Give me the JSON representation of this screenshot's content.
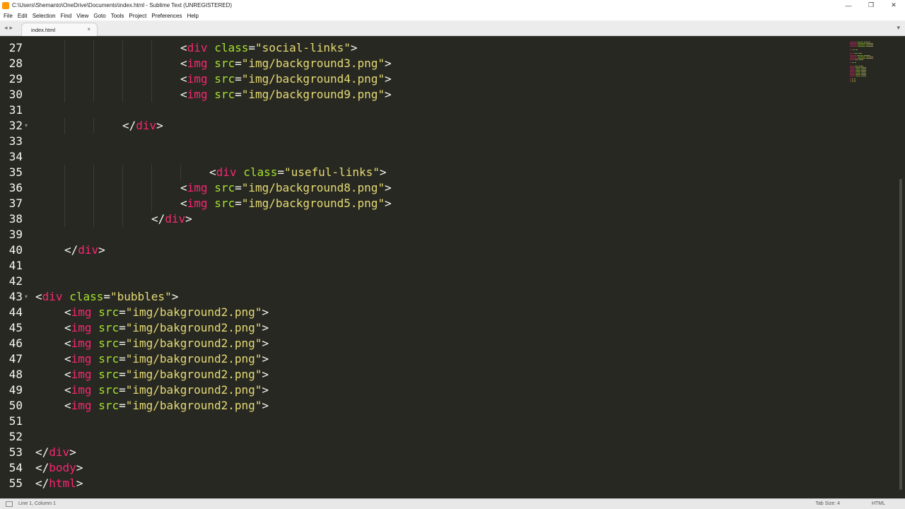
{
  "window": {
    "title": "C:\\Users\\Shemanto\\OneDrive\\Documents\\index.html - Sublime Text (UNREGISTERED)",
    "minimize_label": "—",
    "maximize_label": "❐",
    "close_label": "✕"
  },
  "menu": [
    "File",
    "Edit",
    "Selection",
    "Find",
    "View",
    "Goto",
    "Tools",
    "Project",
    "Preferences",
    "Help"
  ],
  "tabs": {
    "nav_back": "◂",
    "nav_forward": "▸",
    "active": {
      "label": "index.html",
      "close": "×"
    },
    "dropdown": "▾"
  },
  "editor": {
    "lines": [
      {
        "num": "27",
        "tokens": [
          [
            "p",
            "<"
          ],
          [
            "t",
            "div"
          ],
          [
            "x",
            " "
          ],
          [
            "a",
            "class"
          ],
          [
            "p",
            "="
          ],
          [
            "s",
            "\"social-links\""
          ],
          [
            "p",
            ">"
          ]
        ],
        "indent": 205
      },
      {
        "num": "28",
        "tokens": [
          [
            "p",
            "<"
          ],
          [
            "t",
            "img"
          ],
          [
            "x",
            " "
          ],
          [
            "a",
            "src"
          ],
          [
            "p",
            "="
          ],
          [
            "s",
            "\"img/background3.png\""
          ],
          [
            "p",
            ">"
          ]
        ],
        "indent": 205
      },
      {
        "num": "29",
        "tokens": [
          [
            "p",
            "<"
          ],
          [
            "t",
            "img"
          ],
          [
            "x",
            " "
          ],
          [
            "a",
            "src"
          ],
          [
            "p",
            "="
          ],
          [
            "s",
            "\"img/background4.png\""
          ],
          [
            "p",
            ">"
          ]
        ],
        "indent": 205
      },
      {
        "num": "30",
        "tokens": [
          [
            "p",
            "<"
          ],
          [
            "t",
            "img"
          ],
          [
            "x",
            " "
          ],
          [
            "a",
            "src"
          ],
          [
            "p",
            "="
          ],
          [
            "s",
            "\"img/background9.png\""
          ],
          [
            "p",
            ">"
          ]
        ],
        "indent": 205
      },
      {
        "num": "31",
        "tokens": [],
        "indent": 0
      },
      {
        "num": "32",
        "fold": true,
        "tokens": [
          [
            "p",
            "</"
          ],
          [
            "t",
            "div"
          ],
          [
            "p",
            ">"
          ]
        ],
        "indent": 123
      },
      {
        "num": "33",
        "tokens": [],
        "indent": 0
      },
      {
        "num": "34",
        "tokens": [],
        "indent": 0
      },
      {
        "num": "35",
        "tokens": [
          [
            "p",
            "<"
          ],
          [
            "t",
            "div"
          ],
          [
            "x",
            " "
          ],
          [
            "a",
            "class"
          ],
          [
            "p",
            "="
          ],
          [
            "s",
            "\"useful-links\""
          ],
          [
            "p",
            ">"
          ]
        ],
        "indent": 246
      },
      {
        "num": "36",
        "tokens": [
          [
            "p",
            "<"
          ],
          [
            "t",
            "img"
          ],
          [
            "x",
            " "
          ],
          [
            "a",
            "src"
          ],
          [
            "p",
            "="
          ],
          [
            "s",
            "\"img/background8.png\""
          ],
          [
            "p",
            ">"
          ]
        ],
        "indent": 205
      },
      {
        "num": "37",
        "tokens": [
          [
            "p",
            "<"
          ],
          [
            "t",
            "img"
          ],
          [
            "x",
            " "
          ],
          [
            "a",
            "src"
          ],
          [
            "p",
            "="
          ],
          [
            "s",
            "\"img/background5.png\""
          ],
          [
            "p",
            ">"
          ]
        ],
        "indent": 205
      },
      {
        "num": "38",
        "tokens": [
          [
            "p",
            "</"
          ],
          [
            "t",
            "div"
          ],
          [
            "p",
            ">"
          ]
        ],
        "indent": 164
      },
      {
        "num": "39",
        "tokens": [],
        "indent": 0
      },
      {
        "num": "40",
        "tokens": [
          [
            "p",
            "</"
          ],
          [
            "t",
            "div"
          ],
          [
            "p",
            ">"
          ]
        ],
        "indent": 41
      },
      {
        "num": "41",
        "tokens": [],
        "indent": 0
      },
      {
        "num": "42",
        "tokens": [],
        "indent": 0
      },
      {
        "num": "43",
        "fold": true,
        "tokens": [
          [
            "p",
            "<"
          ],
          [
            "t",
            "div"
          ],
          [
            "x",
            " "
          ],
          [
            "a",
            "class"
          ],
          [
            "p",
            "="
          ],
          [
            "s",
            "\"bubbles\""
          ],
          [
            "p",
            ">"
          ]
        ],
        "indent": 0
      },
      {
        "num": "44",
        "tokens": [
          [
            "p",
            "<"
          ],
          [
            "t",
            "img"
          ],
          [
            "x",
            " "
          ],
          [
            "a",
            "src"
          ],
          [
            "p",
            "="
          ],
          [
            "s",
            "\"img/bakground2.png\""
          ],
          [
            "p",
            ">"
          ]
        ],
        "indent": 41
      },
      {
        "num": "45",
        "tokens": [
          [
            "p",
            "<"
          ],
          [
            "t",
            "img"
          ],
          [
            "x",
            " "
          ],
          [
            "a",
            "src"
          ],
          [
            "p",
            "="
          ],
          [
            "s",
            "\"img/bakground2.png\""
          ],
          [
            "p",
            ">"
          ]
        ],
        "indent": 41
      },
      {
        "num": "46",
        "tokens": [
          [
            "p",
            "<"
          ],
          [
            "t",
            "img"
          ],
          [
            "x",
            " "
          ],
          [
            "a",
            "src"
          ],
          [
            "p",
            "="
          ],
          [
            "s",
            "\"img/bakground2.png\""
          ],
          [
            "p",
            ">"
          ]
        ],
        "indent": 41
      },
      {
        "num": "47",
        "tokens": [
          [
            "p",
            "<"
          ],
          [
            "t",
            "img"
          ],
          [
            "x",
            " "
          ],
          [
            "a",
            "src"
          ],
          [
            "p",
            "="
          ],
          [
            "s",
            "\"img/bakground2.png\""
          ],
          [
            "p",
            ">"
          ]
        ],
        "indent": 41
      },
      {
        "num": "48",
        "tokens": [
          [
            "p",
            "<"
          ],
          [
            "t",
            "img"
          ],
          [
            "x",
            " "
          ],
          [
            "a",
            "src"
          ],
          [
            "p",
            "="
          ],
          [
            "s",
            "\"img/bakground2.png\""
          ],
          [
            "p",
            ">"
          ]
        ],
        "indent": 41
      },
      {
        "num": "49",
        "tokens": [
          [
            "p",
            "<"
          ],
          [
            "t",
            "img"
          ],
          [
            "x",
            " "
          ],
          [
            "a",
            "src"
          ],
          [
            "p",
            "="
          ],
          [
            "s",
            "\"img/bakground2.png\""
          ],
          [
            "p",
            ">"
          ]
        ],
        "indent": 41
      },
      {
        "num": "50",
        "tokens": [
          [
            "p",
            "<"
          ],
          [
            "t",
            "img"
          ],
          [
            "x",
            " "
          ],
          [
            "a",
            "src"
          ],
          [
            "p",
            "="
          ],
          [
            "s",
            "\"img/bakground2.png\""
          ],
          [
            "p",
            ">"
          ]
        ],
        "indent": 41
      },
      {
        "num": "51",
        "tokens": [],
        "indent": 0
      },
      {
        "num": "52",
        "tokens": [],
        "indent": 0
      },
      {
        "num": "53",
        "tokens": [
          [
            "p",
            "</"
          ],
          [
            "t",
            "div"
          ],
          [
            "p",
            ">"
          ]
        ],
        "indent": 0
      },
      {
        "num": "54",
        "tokens": [
          [
            "p",
            "</"
          ],
          [
            "t",
            "body"
          ],
          [
            "p",
            ">"
          ]
        ],
        "indent": 0
      },
      {
        "num": "55",
        "tokens": [
          [
            "p",
            "</"
          ],
          [
            "t",
            "html"
          ],
          [
            "p",
            ">"
          ]
        ],
        "indent": 0
      }
    ],
    "colors": {
      "background": "#272822",
      "tag": "#f92672",
      "attribute": "#a6e22e",
      "string": "#e6db74",
      "text": "#f8f8f2"
    }
  },
  "status": {
    "position": "Line 1, Column 1",
    "tab_size": "Tab Size: 4",
    "syntax": "HTML"
  }
}
